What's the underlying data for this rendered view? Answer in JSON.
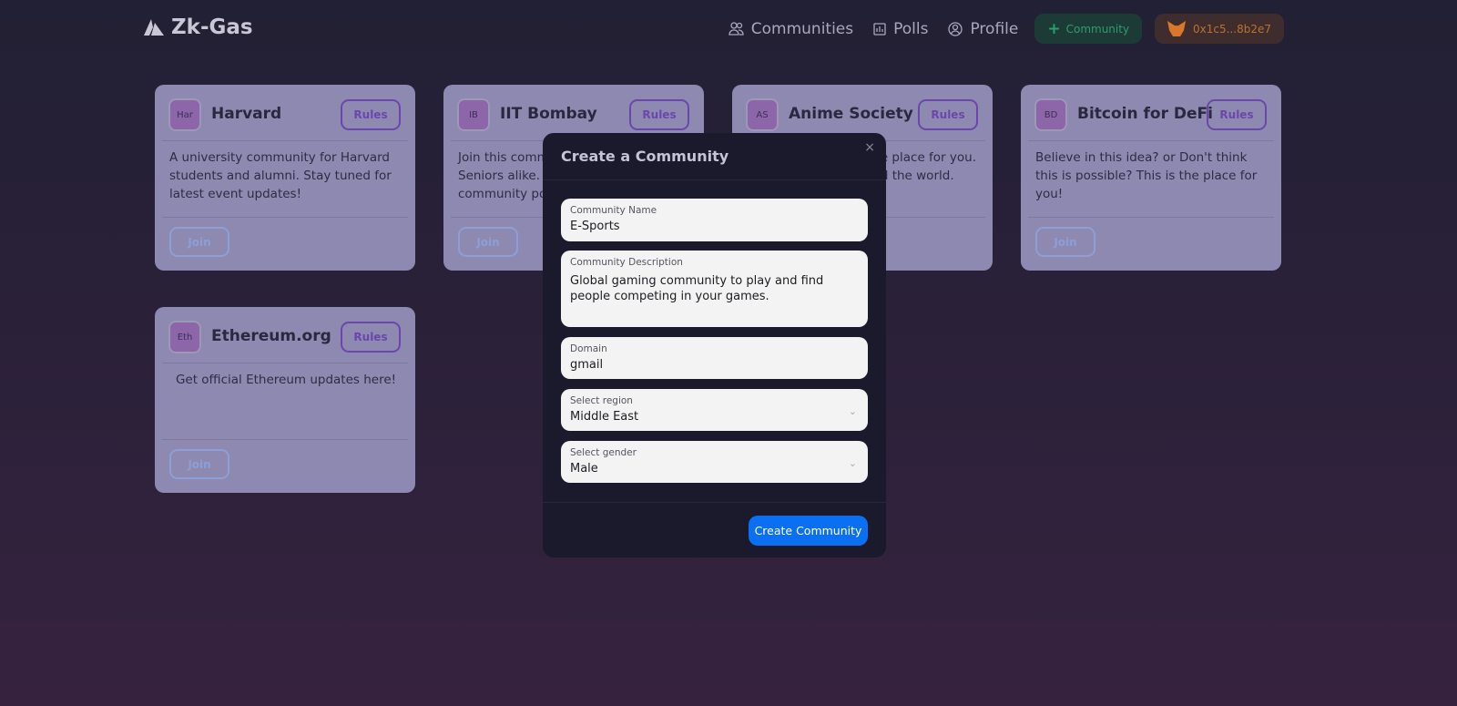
{
  "app": {
    "name": "Zk-Gas",
    "logo_icon": "triangle-logo-icon"
  },
  "nav": {
    "links": [
      {
        "label": "Communities",
        "icon": "users-icon"
      },
      {
        "label": "Polls",
        "icon": "chart-icon"
      },
      {
        "label": "Profile",
        "icon": "user-circle-icon"
      }
    ],
    "create_button": "Community",
    "wallet_address": "0x1c5...8b2e7"
  },
  "cards": [
    {
      "avatar": "Har",
      "name": "Harvard",
      "rules": "Rules",
      "description": "A university community for Harvard students and alumni. Stay tuned for latest event updates!",
      "join": "Join"
    },
    {
      "avatar": "IB",
      "name": "IIT Bombay",
      "rules": "Rules",
      "description_visible_lines": [
        "Join this comm",
        "Seniors alike. V",
        "community pol"
      ],
      "join": "Join"
    },
    {
      "avatar": "AS",
      "name": "Anime Society",
      "rules": "Rules",
      "description_visible_lines": [
        "he place for you.",
        "nd the world."
      ],
      "join": "Join"
    },
    {
      "avatar": "BD",
      "name": "Bitcoin for DeFi",
      "rules": "Rules",
      "description": "Believe in this idea? or Don't think this is possible? This is the place for you!",
      "join": "Join"
    },
    {
      "avatar": "Eth",
      "name": "Ethereum.org",
      "rules": "Rules",
      "description": "Get official Ethereum updates here!",
      "join": "Join"
    }
  ],
  "modal": {
    "title": "Create a Community",
    "close": "×",
    "fields": {
      "name": {
        "label": "Community Name",
        "value": "E-Sports"
      },
      "description": {
        "label": "Community Description",
        "value": "Global gaming community to play and find people competing in your games."
      },
      "domain": {
        "label": "Domain",
        "value": "gmail"
      },
      "region": {
        "label": "Select region",
        "value": "Middle East"
      },
      "gender": {
        "label": "Select gender",
        "value": "Male"
      }
    },
    "submit": "Create Community"
  },
  "colors": {
    "primary": "#0a6ff0",
    "accent_purple": "#6b47ad",
    "success": "#2e9e6b",
    "wallet": "#b8732e"
  }
}
